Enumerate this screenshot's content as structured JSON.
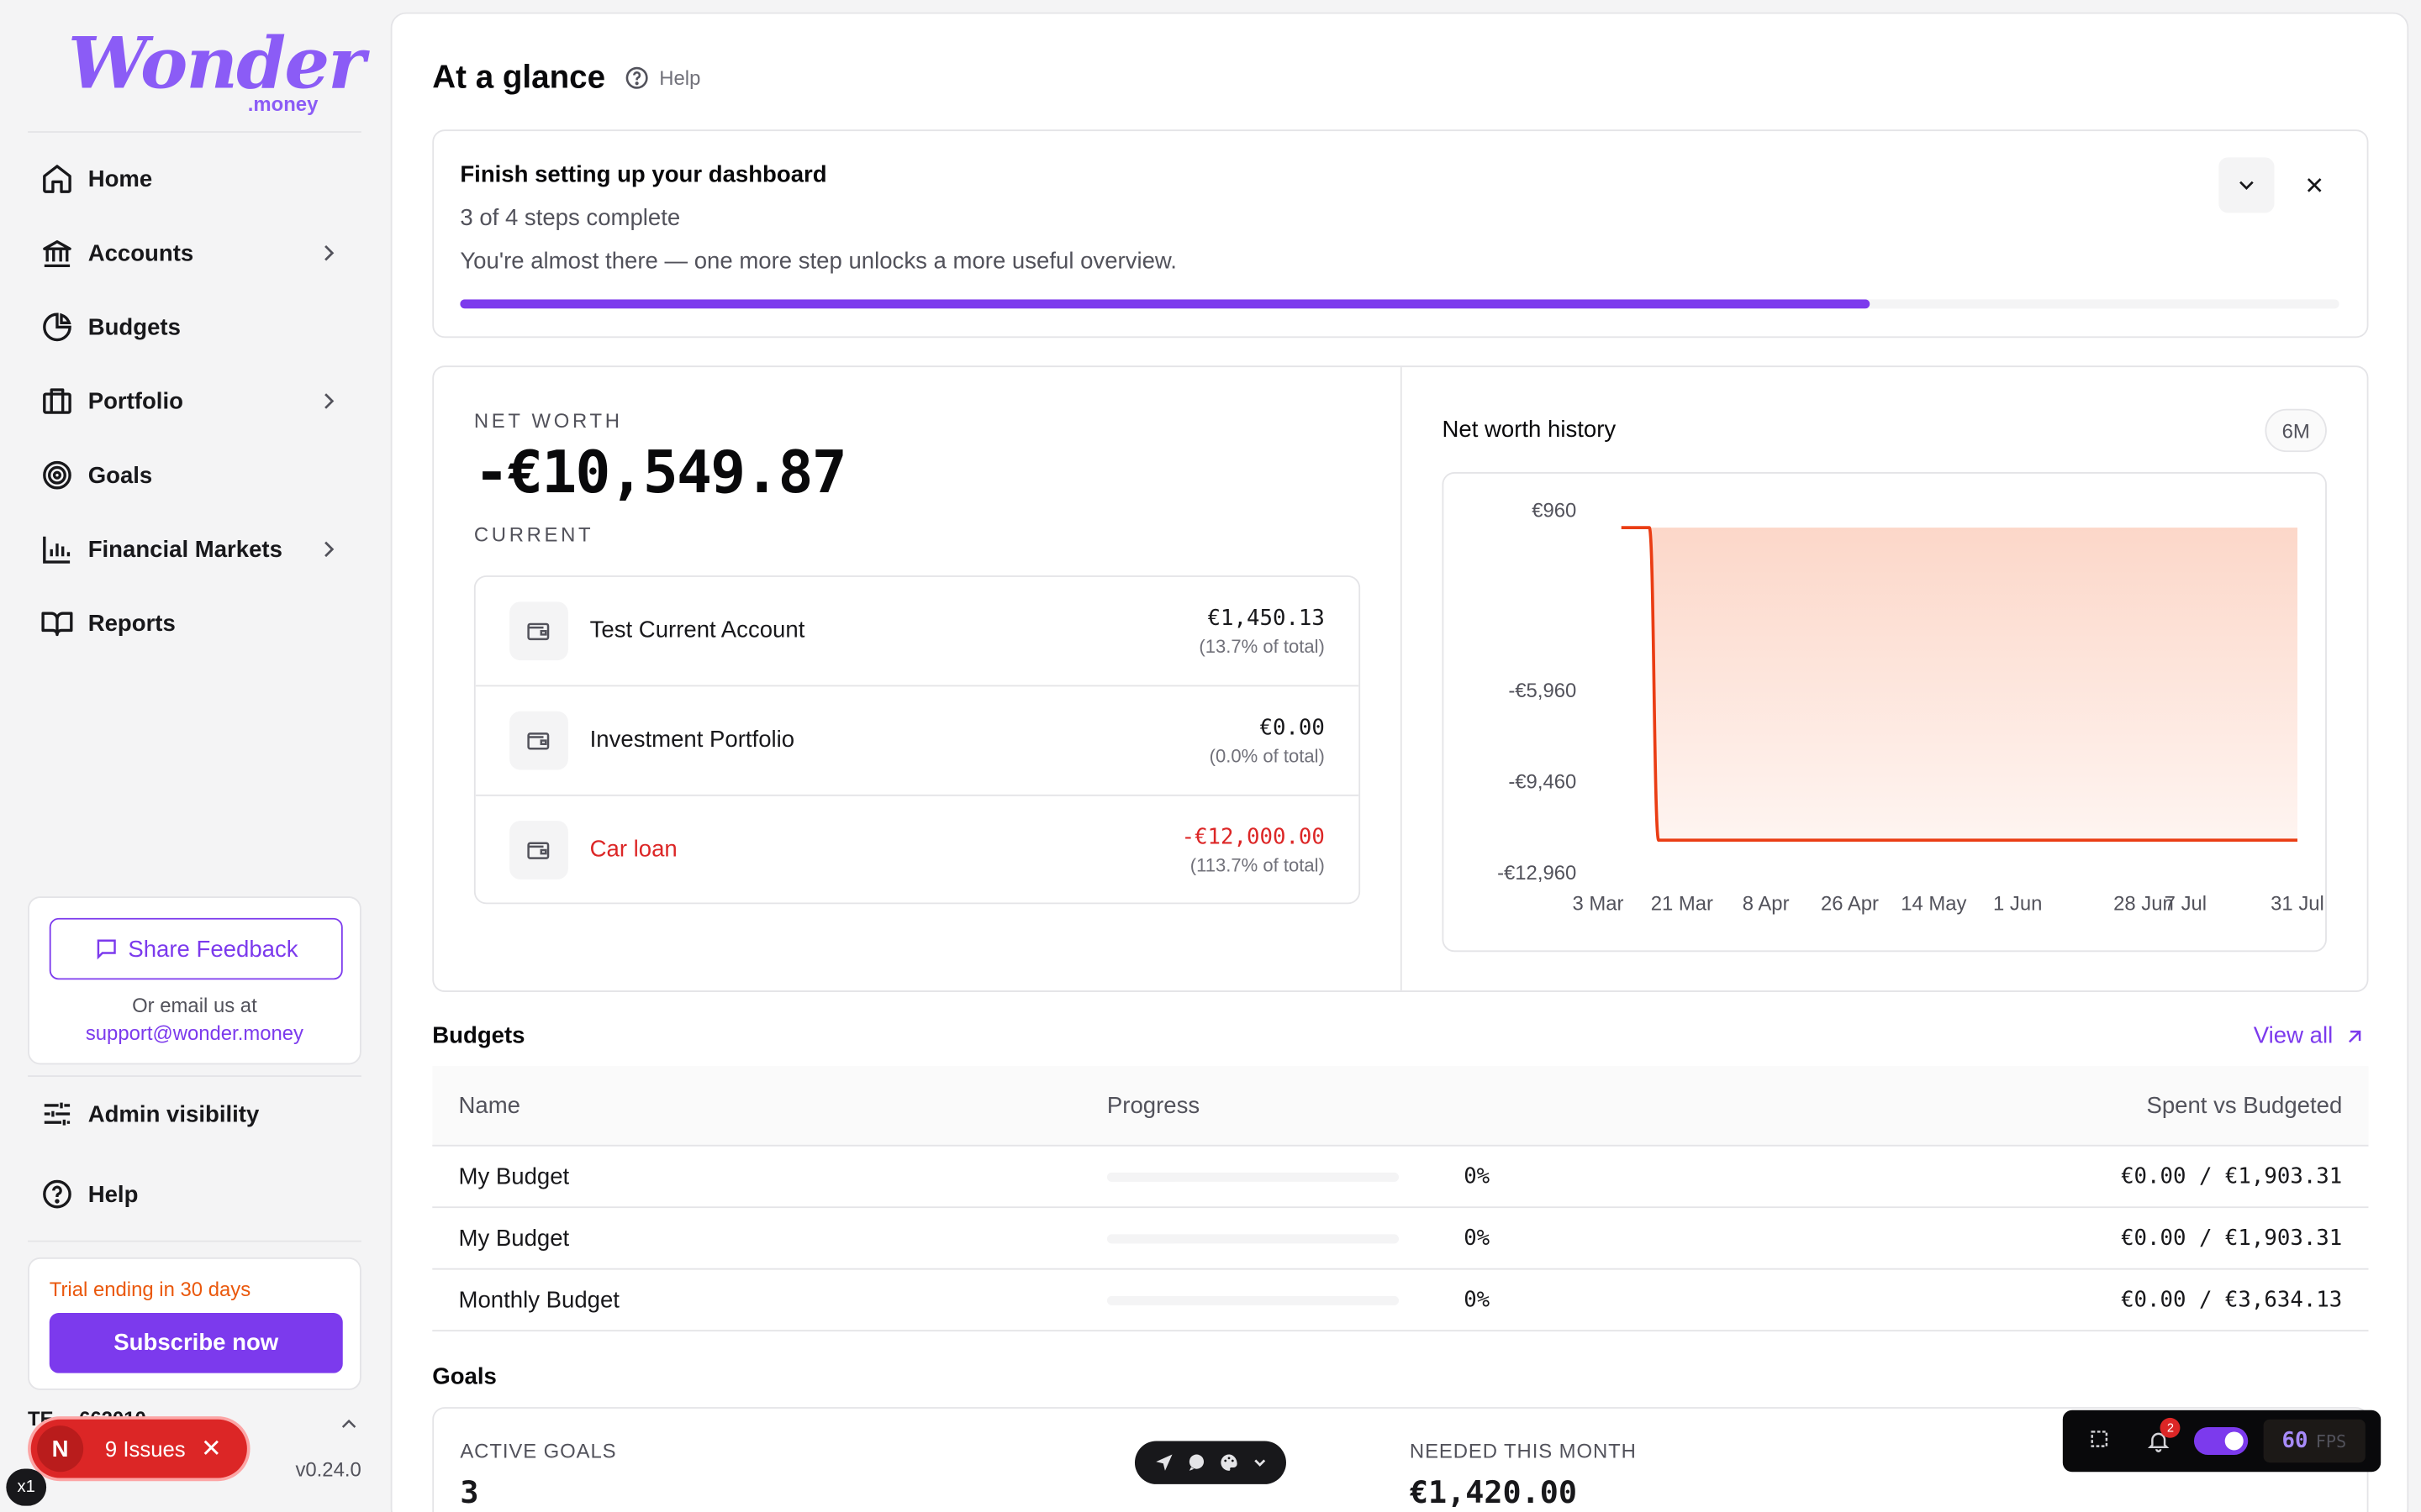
{
  "brand": {
    "name": "Wonder",
    "suffix": ".money"
  },
  "sidebar": {
    "items": [
      {
        "label": "Home",
        "icon": "home-icon",
        "has_submenu": false
      },
      {
        "label": "Accounts",
        "icon": "bank-icon",
        "has_submenu": true
      },
      {
        "label": "Budgets",
        "icon": "pie-chart-icon",
        "has_submenu": false
      },
      {
        "label": "Portfolio",
        "icon": "briefcase-icon",
        "has_submenu": true
      },
      {
        "label": "Goals",
        "icon": "target-icon",
        "has_submenu": false
      },
      {
        "label": "Financial Markets",
        "icon": "bar-chart-icon",
        "has_submenu": true
      },
      {
        "label": "Reports",
        "icon": "book-icon",
        "has_submenu": false
      }
    ],
    "feedback": {
      "button": "Share Feedback",
      "email_label": "Or email us at",
      "email": "support@wonder.money"
    },
    "admin_visibility": "Admin visibility",
    "help": "Help",
    "trial": {
      "text": "Trial ending in 30 days",
      "button": "Subscribe now"
    },
    "user": "TE…           662010…",
    "version": "v0.24.0"
  },
  "header": {
    "title": "At a glance",
    "help": "Help"
  },
  "setup": {
    "title": "Finish setting up your dashboard",
    "steps": "3 of 4 steps complete",
    "description": "You're almost there — one more step unlocks a more useful overview.",
    "progress": 0.75
  },
  "net_worth": {
    "label": "NET WORTH",
    "value": "-€10,549.87",
    "sublabel": "CURRENT",
    "accounts": [
      {
        "name": "Test Current Account",
        "amount": "€1,450.13",
        "pct": "(13.7% of total)",
        "negative": false
      },
      {
        "name": "Investment Portfolio",
        "amount": "€0.00",
        "pct": "(0.0% of total)",
        "negative": false
      },
      {
        "name": "Car loan",
        "amount": "-€12,000.00",
        "pct": "(113.7% of total)",
        "negative": true
      }
    ]
  },
  "history": {
    "title": "Net worth history",
    "range": "6M"
  },
  "chart_data": {
    "type": "area",
    "title": "Net worth history",
    "x_ticks": [
      "3 Mar",
      "21 Mar",
      "8 Apr",
      "26 Apr",
      "14 May",
      "1 Jun",
      "28 Jun",
      "7 Jul",
      "31 Jul"
    ],
    "y_ticks": [
      960,
      -5960,
      -9460,
      -12960
    ],
    "y_tick_labels": [
      "€960",
      "-€5,960",
      "-€9,460",
      "-€12,960"
    ],
    "ylim": [
      -12960,
      960
    ],
    "x_range": [
      "3 Mar",
      "31 Jul"
    ],
    "series": [
      {
        "x": [
          "8 Mar",
          "14 Mar",
          "16 Mar",
          "31 Jul"
        ],
        "y": [
          250,
          250,
          -11750,
          -11750
        ]
      }
    ],
    "color": "#ea3d14",
    "fill": "#fcd5c6",
    "grid": false,
    "legend": "none"
  },
  "budgets": {
    "title": "Budgets",
    "view_all": "View all",
    "columns": [
      "Name",
      "Progress",
      "Spent vs Budgeted"
    ],
    "rows": [
      {
        "name": "My Budget",
        "progress": 0,
        "pct": "0%",
        "spent": "€0.00 / €1,903.31"
      },
      {
        "name": "My Budget",
        "progress": 0,
        "pct": "0%",
        "spent": "€0.00 / €1,903.31"
      },
      {
        "name": "Monthly Budget",
        "progress": 0,
        "pct": "0%",
        "spent": "€0.00 / €3,634.13"
      }
    ]
  },
  "goals": {
    "title": "Goals",
    "active_label": "ACTIVE GOALS",
    "active_value": "3",
    "needed_label": "NEEDED THIS MONTH",
    "needed_value": "€1,420.00"
  },
  "dev": {
    "issues": "9 Issues",
    "issues_letter": "N",
    "zoom": "x1",
    "notif_count": "2",
    "fps": "60",
    "fps_unit": "FPS"
  },
  "colors": {
    "accent": "#7c3aed",
    "negative": "#dc2626",
    "trial": "#ea580c"
  }
}
